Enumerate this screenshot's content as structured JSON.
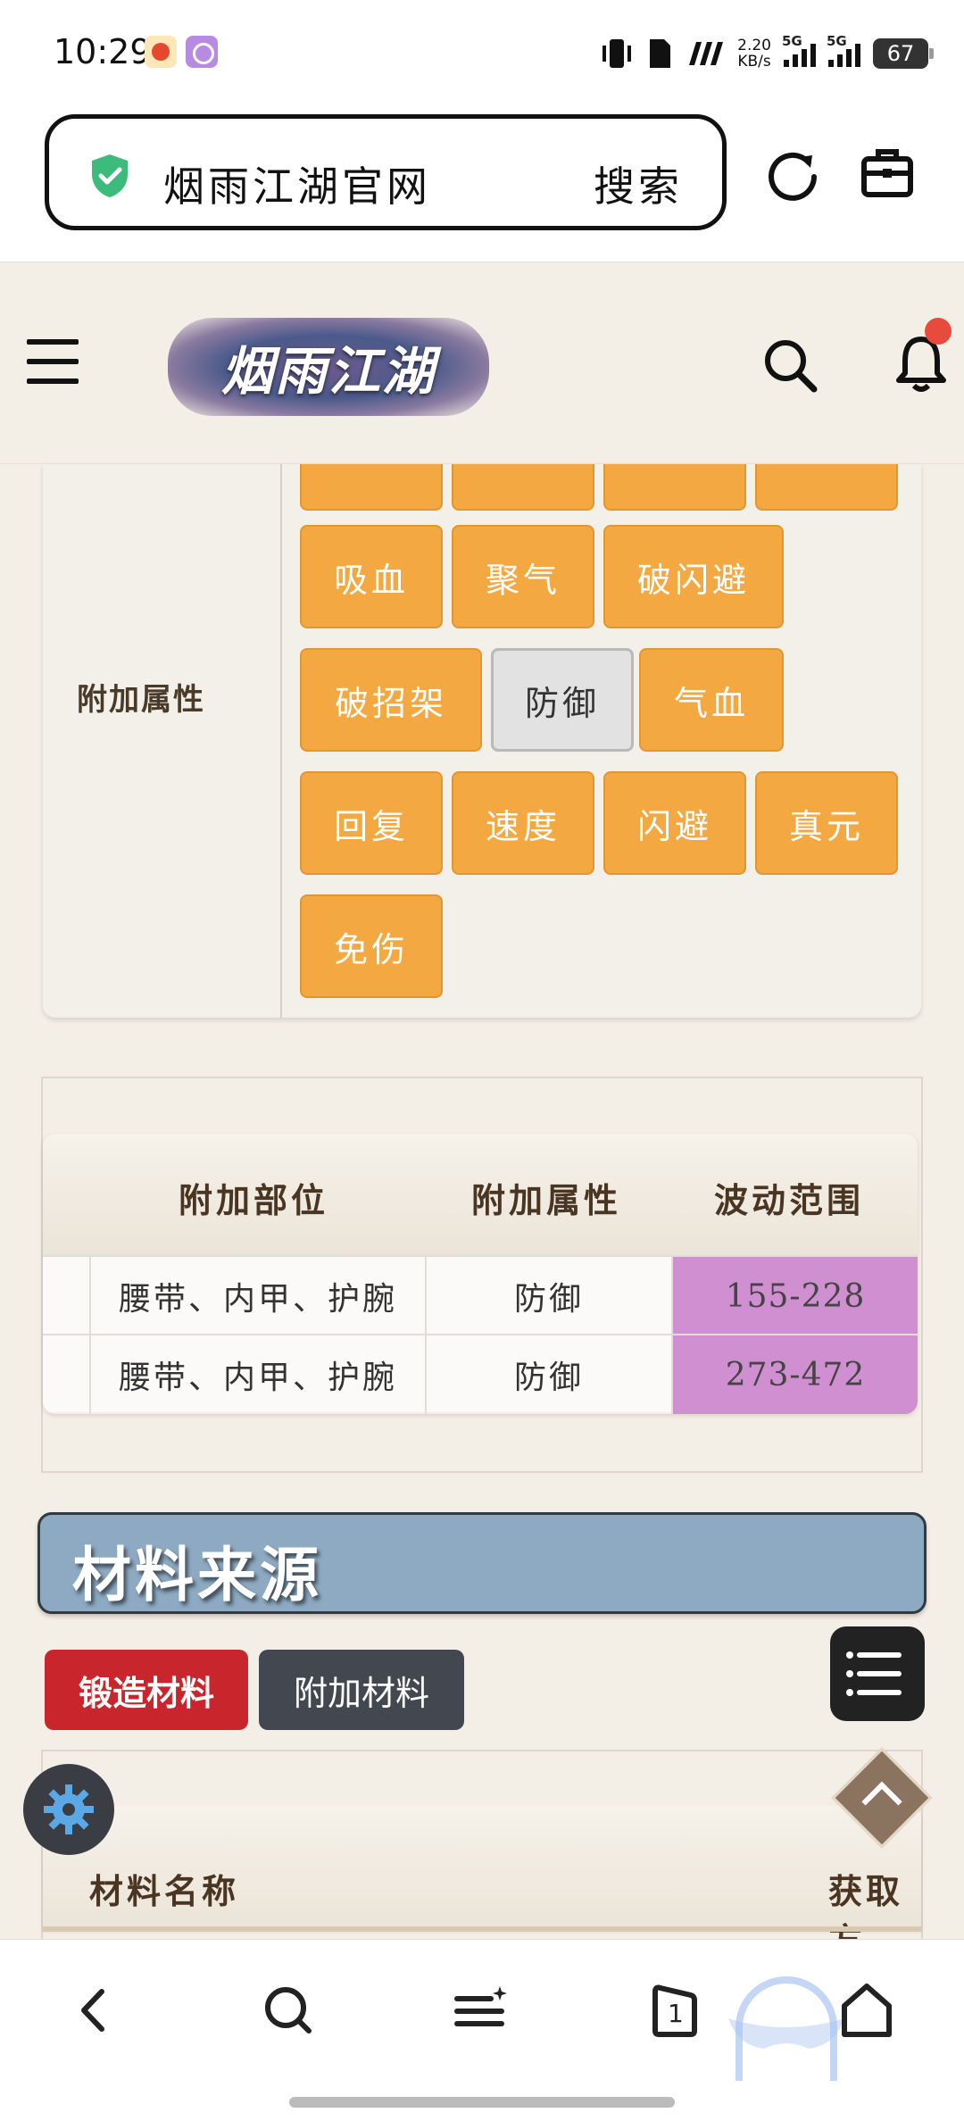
{
  "status_bar": {
    "time": "10:29",
    "net_speed_value": "2.20",
    "net_speed_unit": "KB/s",
    "signal_1": "5G",
    "signal_2": "5G",
    "battery": "67",
    "icons": [
      "tomato-app-icon",
      "purple-app-icon",
      "vibrate-icon",
      "sim-icon",
      "carrier-icon",
      "signal-icon",
      "battery-icon"
    ]
  },
  "browser": {
    "site_name": "烟雨江湖官网",
    "search_label": "搜索",
    "icons": [
      "shield-check-icon",
      "reload-icon",
      "toolbox-icon"
    ]
  },
  "site_header": {
    "logo_text": "烟雨江湖",
    "icons": [
      "menu-icon",
      "search-icon",
      "bell-icon"
    ]
  },
  "attr_panel": {
    "label": "附加属性",
    "chips_row0": [
      "",
      "",
      "",
      ""
    ],
    "chips_row1": [
      "吸血",
      "聚气",
      "破闪避"
    ],
    "chips_row2": [
      "破招架",
      "防御",
      "气血"
    ],
    "chips_row3": [
      "回复",
      "速度",
      "闪避",
      "真元"
    ],
    "chips_row4": [
      "免伤"
    ],
    "selected": "防御"
  },
  "table": {
    "headers": [
      "附加部位",
      "附加属性",
      "波动范围"
    ],
    "rows": [
      {
        "part": "腰带、内甲、护腕",
        "attr": "防御",
        "range": "155-228"
      },
      {
        "part": "腰带、内甲、护腕",
        "attr": "防御",
        "range": "273-472"
      }
    ]
  },
  "materials": {
    "section_title": "材料来源",
    "tabs": [
      "锻造材料",
      "附加材料"
    ],
    "headers": [
      "材料名称",
      "获取方"
    ]
  },
  "bottom_nav": {
    "tab_count": "1",
    "icons": [
      "back-icon",
      "search-icon",
      "menu-plus-icon",
      "tabs-icon",
      "home-icon"
    ]
  },
  "colors": {
    "chip": "#f4a841",
    "chip_selected": "#e2e2e2",
    "range_cell": "#cf8fd0",
    "section_bar": "#8daac2",
    "tab_active": "#c8262c",
    "tab_inactive": "#434850",
    "page_bg": "#f4efe6"
  }
}
